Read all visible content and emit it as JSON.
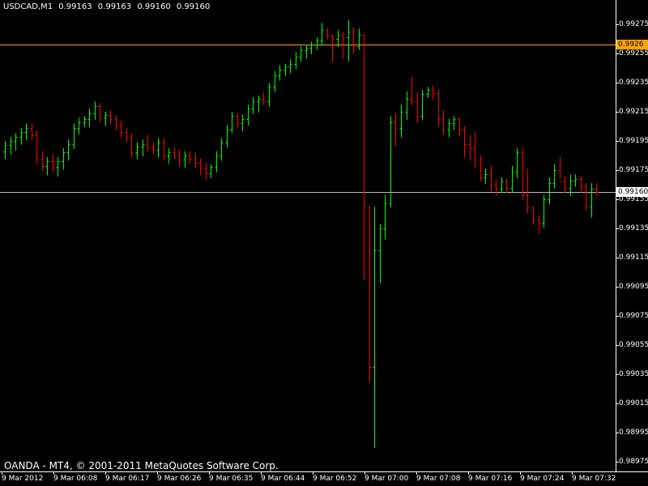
{
  "window": {
    "symbol": "USDCAD,M1",
    "ohlc": [
      "0.99163",
      "0.99163",
      "0.99160",
      "0.99160"
    ],
    "copyright": "OANDA - MT4, © 2001-2011 MetaQuotes Software Corp."
  },
  "colors": {
    "background": "#000000",
    "bull": "#00FF00",
    "bear": "#FF0000",
    "ask_line": "#FFA500",
    "bid_line": "#C0C0C0",
    "text": "#FFFFFF"
  },
  "price_lines": {
    "ask": "0.9926",
    "bid": "0.99160"
  },
  "chart_data": {
    "type": "ohlc",
    "yticks": [
      "0.99275",
      "0.99255",
      "0.99235",
      "0.99215",
      "0.99195",
      "0.99175",
      "0.99155",
      "0.99135",
      "0.99115",
      "0.99095",
      "0.99075",
      "0.99055",
      "0.99035",
      "0.99015",
      "0.98995",
      "0.98975"
    ],
    "xticks": [
      "9 Mar 2012",
      "9 Mar 06:08",
      "9 Mar 06:17",
      "9 Mar 06:26",
      "9 Mar 06:35",
      "9 Mar 06:44",
      "9 Mar 06:52",
      "9 Mar 07:00",
      "9 Mar 07:08",
      "9 Mar 07:16",
      "9 Mar 07:24",
      "9 Mar 07:32"
    ],
    "ylim": [
      0.9897,
      0.99285
    ],
    "ask_price": 0.99261,
    "bid_price": 0.9916,
    "bars": [
      [
        0.99188,
        0.99195,
        0.99183,
        0.99192
      ],
      [
        0.99192,
        0.99198,
        0.99186,
        0.99195
      ],
      [
        0.99195,
        0.992,
        0.99189,
        0.99198
      ],
      [
        0.99198,
        0.99204,
        0.99193,
        0.99201
      ],
      [
        0.99201,
        0.99207,
        0.99196,
        0.99204
      ],
      [
        0.99204,
        0.99207,
        0.99196,
        0.99199
      ],
      [
        0.99199,
        0.99202,
        0.9918,
        0.99183
      ],
      [
        0.99183,
        0.99188,
        0.99175,
        0.99178
      ],
      [
        0.99178,
        0.99184,
        0.99172,
        0.99181
      ],
      [
        0.99181,
        0.99186,
        0.99174,
        0.99177
      ],
      [
        0.99177,
        0.99184,
        0.99171,
        0.99181
      ],
      [
        0.99181,
        0.9919,
        0.99176,
        0.99187
      ],
      [
        0.99187,
        0.99196,
        0.99182,
        0.99193
      ],
      [
        0.99193,
        0.99207,
        0.9919,
        0.99204
      ],
      [
        0.99204,
        0.99211,
        0.992,
        0.99208
      ],
      [
        0.99208,
        0.99212,
        0.99205,
        0.9921
      ],
      [
        0.9921,
        0.99217,
        0.99205,
        0.99214
      ],
      [
        0.99214,
        0.99222,
        0.9921,
        0.99219
      ],
      [
        0.99219,
        0.99221,
        0.99208,
        0.99211
      ],
      [
        0.99211,
        0.99215,
        0.99206,
        0.99213
      ],
      [
        0.99213,
        0.99216,
        0.99207,
        0.9921
      ],
      [
        0.9921,
        0.99213,
        0.99203,
        0.99206
      ],
      [
        0.99206,
        0.99209,
        0.99198,
        0.99201
      ],
      [
        0.99201,
        0.99204,
        0.99195,
        0.99198
      ],
      [
        0.99198,
        0.992,
        0.99184,
        0.99187
      ],
      [
        0.99187,
        0.99194,
        0.99183,
        0.99191
      ],
      [
        0.99191,
        0.99196,
        0.99185,
        0.99193
      ],
      [
        0.99193,
        0.99199,
        0.99188,
        0.99191
      ],
      [
        0.99191,
        0.99194,
        0.99186,
        0.99189
      ],
      [
        0.99189,
        0.99197,
        0.99184,
        0.99194
      ],
      [
        0.99194,
        0.99197,
        0.99182,
        0.99185
      ],
      [
        0.99185,
        0.9919,
        0.9918,
        0.99187
      ],
      [
        0.99187,
        0.99191,
        0.99183,
        0.99185
      ],
      [
        0.99185,
        0.99189,
        0.99178,
        0.99182
      ],
      [
        0.99182,
        0.99188,
        0.99177,
        0.99185
      ],
      [
        0.99185,
        0.99188,
        0.9918,
        0.99183
      ],
      [
        0.99183,
        0.99187,
        0.99177,
        0.9918
      ],
      [
        0.9918,
        0.99183,
        0.99172,
        0.99176
      ],
      [
        0.99176,
        0.9918,
        0.99169,
        0.99173
      ],
      [
        0.99173,
        0.99179,
        0.9917,
        0.99177
      ],
      [
        0.99177,
        0.99188,
        0.99174,
        0.99185
      ],
      [
        0.99185,
        0.99197,
        0.99182,
        0.99194
      ],
      [
        0.99194,
        0.99206,
        0.99191,
        0.99203
      ],
      [
        0.99203,
        0.99215,
        0.99201,
        0.99212
      ],
      [
        0.99212,
        0.99214,
        0.99204,
        0.99207
      ],
      [
        0.99207,
        0.99213,
        0.99202,
        0.9921
      ],
      [
        0.9921,
        0.9922,
        0.99206,
        0.99217
      ],
      [
        0.99217,
        0.99225,
        0.99214,
        0.99222
      ],
      [
        0.99222,
        0.99226,
        0.99215,
        0.99224
      ],
      [
        0.99224,
        0.99228,
        0.9922,
        0.99222
      ],
      [
        0.99222,
        0.99235,
        0.99219,
        0.99232
      ],
      [
        0.99232,
        0.99243,
        0.99229,
        0.9924
      ],
      [
        0.9924,
        0.99247,
        0.99237,
        0.99244
      ],
      [
        0.99244,
        0.99248,
        0.9924,
        0.99246
      ],
      [
        0.99246,
        0.99251,
        0.99242,
        0.99248
      ],
      [
        0.99248,
        0.99256,
        0.99245,
        0.99253
      ],
      [
        0.99253,
        0.9926,
        0.9925,
        0.99257
      ],
      [
        0.99257,
        0.99261,
        0.99252,
        0.99259
      ],
      [
        0.99259,
        0.99263,
        0.99255,
        0.99261
      ],
      [
        0.99261,
        0.99266,
        0.99258,
        0.99264
      ],
      [
        0.99264,
        0.99276,
        0.99261,
        0.99271
      ],
      [
        0.99271,
        0.99272,
        0.99265,
        0.99267
      ],
      [
        0.99267,
        0.99268,
        0.9925,
        0.99265
      ],
      [
        0.99265,
        0.99271,
        0.9926,
        0.99268
      ],
      [
        0.99268,
        0.9927,
        0.99252,
        0.99266
      ],
      [
        0.99266,
        0.99278,
        0.9925,
        0.9927
      ],
      [
        0.9927,
        0.99273,
        0.99255,
        0.9926
      ],
      [
        0.9926,
        0.99272,
        0.99258,
        0.99268
      ],
      [
        0.99268,
        0.99268,
        0.991,
        0.9915
      ],
      [
        0.9915,
        0.9915,
        0.9903,
        0.9904
      ],
      [
        0.9904,
        0.9915,
        0.98985,
        0.9912
      ],
      [
        0.9912,
        0.99138,
        0.99098,
        0.99135
      ],
      [
        0.99135,
        0.99158,
        0.99128,
        0.99152
      ],
      [
        0.99152,
        0.99212,
        0.9915,
        0.99208
      ],
      [
        0.99208,
        0.99214,
        0.99192,
        0.99204
      ],
      [
        0.99204,
        0.9922,
        0.99198,
        0.99215
      ],
      [
        0.99215,
        0.99229,
        0.9921,
        0.99224
      ],
      [
        0.99224,
        0.99239,
        0.9922,
        0.99222
      ],
      [
        0.99222,
        0.99228,
        0.99208,
        0.99212
      ],
      [
        0.99212,
        0.9923,
        0.9921,
        0.99227
      ],
      [
        0.99227,
        0.99232,
        0.99225,
        0.9923
      ],
      [
        0.9923,
        0.99233,
        0.99224,
        0.99228
      ],
      [
        0.99228,
        0.9923,
        0.99205,
        0.9921
      ],
      [
        0.9921,
        0.99216,
        0.992,
        0.99203
      ],
      [
        0.99203,
        0.9921,
        0.99198,
        0.99207
      ],
      [
        0.99207,
        0.99212,
        0.99203,
        0.9921
      ],
      [
        0.9921,
        0.99211,
        0.99199,
        0.99203
      ],
      [
        0.99203,
        0.99205,
        0.99184,
        0.99193
      ],
      [
        0.99193,
        0.99199,
        0.99182,
        0.9919
      ],
      [
        0.9919,
        0.99201,
        0.99177,
        0.99182
      ],
      [
        0.99182,
        0.99185,
        0.99168,
        0.9917
      ],
      [
        0.9917,
        0.99176,
        0.99166,
        0.99172
      ],
      [
        0.99172,
        0.99178,
        0.99161,
        0.99165
      ],
      [
        0.99165,
        0.99168,
        0.99158,
        0.99162
      ],
      [
        0.99162,
        0.9917,
        0.9916,
        0.99167
      ],
      [
        0.99167,
        0.99169,
        0.9916,
        0.99163
      ],
      [
        0.99163,
        0.99178,
        0.9916,
        0.99174
      ],
      [
        0.99174,
        0.9919,
        0.9917,
        0.99187
      ],
      [
        0.99187,
        0.9919,
        0.99155,
        0.99158
      ],
      [
        0.99158,
        0.99176,
        0.99146,
        0.9915
      ],
      [
        0.9915,
        0.9915,
        0.99138,
        0.99141
      ],
      [
        0.99141,
        0.99144,
        0.99132,
        0.99139
      ],
      [
        0.99139,
        0.99158,
        0.99136,
        0.99155
      ],
      [
        0.99155,
        0.9917,
        0.99152,
        0.99166
      ],
      [
        0.99166,
        0.99179,
        0.99163,
        0.99175
      ],
      [
        0.99175,
        0.99184,
        0.9917,
        0.99167
      ],
      [
        0.99167,
        0.99171,
        0.9916,
        0.99163
      ],
      [
        0.99163,
        0.99172,
        0.99158,
        0.99168
      ],
      [
        0.99168,
        0.99172,
        0.99164,
        0.99169
      ],
      [
        0.99169,
        0.99171,
        0.9916,
        0.99164
      ],
      [
        0.99164,
        0.99166,
        0.99148,
        0.9915
      ],
      [
        0.9915,
        0.99166,
        0.99143,
        0.99162
      ],
      [
        0.99162,
        0.99166,
        0.99158,
        0.9916
      ]
    ]
  }
}
